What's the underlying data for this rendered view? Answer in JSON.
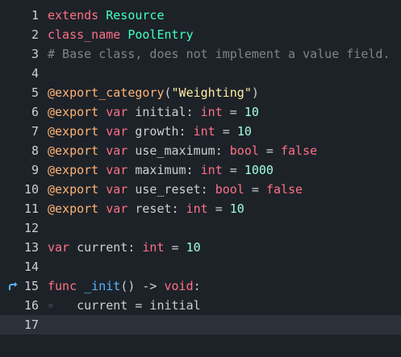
{
  "editor": {
    "colors": {
      "background": "#1d2229",
      "current_line": "#2c3139",
      "keyword": "#ff7085",
      "type": "#42ffc2",
      "comment": "#808489",
      "annotation": "#ffb373",
      "string": "#ffeda1",
      "number": "#a1ffe0",
      "function": "#57b3ff"
    },
    "lines": [
      {
        "n": "1",
        "tokens": [
          [
            "kw",
            "extends"
          ],
          [
            "id",
            " "
          ],
          [
            "type",
            "Resource"
          ]
        ]
      },
      {
        "n": "2",
        "tokens": [
          [
            "kw",
            "class_name"
          ],
          [
            "id",
            " "
          ],
          [
            "type",
            "PoolEntry"
          ]
        ]
      },
      {
        "n": "3",
        "tokens": [
          [
            "cm",
            "# Base class, does not implement a value field."
          ]
        ]
      },
      {
        "n": "4",
        "tokens": []
      },
      {
        "n": "5",
        "tokens": [
          [
            "an",
            "@export_category"
          ],
          [
            "id",
            "("
          ],
          [
            "str",
            "\"Weighting\""
          ],
          [
            "id",
            ")"
          ]
        ]
      },
      {
        "n": "6",
        "tokens": [
          [
            "an",
            "@export"
          ],
          [
            "id",
            " "
          ],
          [
            "kw",
            "var"
          ],
          [
            "id",
            " initial: "
          ],
          [
            "kw",
            "int"
          ],
          [
            "id",
            " = "
          ],
          [
            "num",
            "10"
          ]
        ]
      },
      {
        "n": "7",
        "tokens": [
          [
            "an",
            "@export"
          ],
          [
            "id",
            " "
          ],
          [
            "kw",
            "var"
          ],
          [
            "id",
            " growth: "
          ],
          [
            "kw",
            "int"
          ],
          [
            "id",
            " = "
          ],
          [
            "num",
            "10"
          ]
        ]
      },
      {
        "n": "8",
        "tokens": [
          [
            "an",
            "@export"
          ],
          [
            "id",
            " "
          ],
          [
            "kw",
            "var"
          ],
          [
            "id",
            " use_maximum: "
          ],
          [
            "kw",
            "bool"
          ],
          [
            "id",
            " = "
          ],
          [
            "kw",
            "false"
          ]
        ]
      },
      {
        "n": "9",
        "tokens": [
          [
            "an",
            "@export"
          ],
          [
            "id",
            " "
          ],
          [
            "kw",
            "var"
          ],
          [
            "id",
            " maximum: "
          ],
          [
            "kw",
            "int"
          ],
          [
            "id",
            " = "
          ],
          [
            "num",
            "1000"
          ]
        ]
      },
      {
        "n": "10",
        "tokens": [
          [
            "an",
            "@export"
          ],
          [
            "id",
            " "
          ],
          [
            "kw",
            "var"
          ],
          [
            "id",
            " use_reset: "
          ],
          [
            "kw",
            "bool"
          ],
          [
            "id",
            " = "
          ],
          [
            "kw",
            "false"
          ]
        ]
      },
      {
        "n": "11",
        "tokens": [
          [
            "an",
            "@export"
          ],
          [
            "id",
            " "
          ],
          [
            "kw",
            "var"
          ],
          [
            "id",
            " reset: "
          ],
          [
            "kw",
            "int"
          ],
          [
            "id",
            " = "
          ],
          [
            "num",
            "10"
          ]
        ]
      },
      {
        "n": "12",
        "tokens": []
      },
      {
        "n": "13",
        "tokens": [
          [
            "kw",
            "var"
          ],
          [
            "id",
            " current: "
          ],
          [
            "kw",
            "int"
          ],
          [
            "id",
            " = "
          ],
          [
            "num",
            "10"
          ]
        ]
      },
      {
        "n": "14",
        "tokens": []
      },
      {
        "n": "15",
        "marker": "override-icon",
        "tokens": [
          [
            "kw",
            "func"
          ],
          [
            "id",
            " "
          ],
          [
            "fn",
            "_init"
          ],
          [
            "id",
            "() -> "
          ],
          [
            "kw",
            "void"
          ],
          [
            "id",
            ":"
          ]
        ]
      },
      {
        "n": "16",
        "tab": true,
        "tokens": [
          [
            "id",
            "    current = initial"
          ]
        ]
      },
      {
        "n": "17",
        "current": true,
        "tokens": []
      }
    ]
  }
}
